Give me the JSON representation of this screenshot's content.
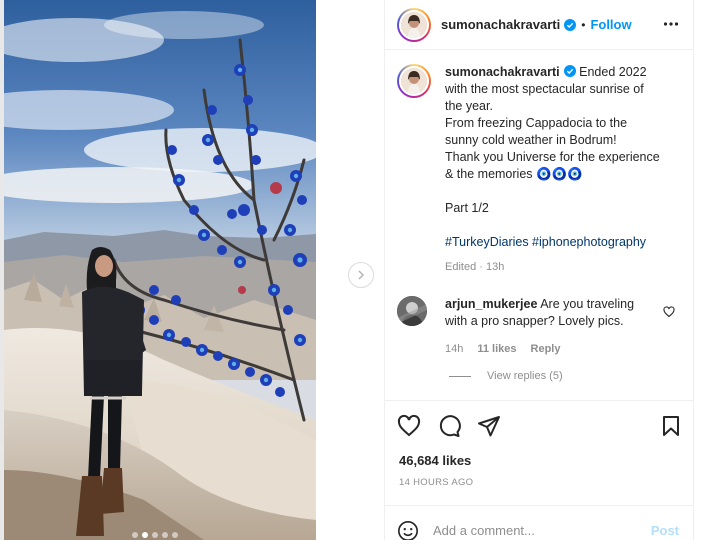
{
  "post": {
    "username": "sumonachakravarti",
    "verified": true,
    "separator": "•",
    "follow_label": "Follow",
    "more_icon": "more-horizontal-icon",
    "caption": {
      "lines": [
        "Ended 2022",
        "with the most spectacular sunrise of",
        "the year.",
        "From freezing Cappadocia to the",
        "sunny cold weather in Bodrum!",
        "Thank you Universe for the experience",
        "& the memories 🧿🧿🧿"
      ],
      "part": "Part 1/2",
      "hashtags": "#TurkeyDiaries #iphonephotography",
      "edited": "Edited · 13h"
    },
    "comment": {
      "username": "arjun_mukerjee",
      "text": "Are you traveling with a pro snapper? Lovely pics.",
      "time": "14h",
      "likes": "11 likes",
      "reply_label": "Reply",
      "view_replies": "View replies (5)"
    },
    "likes": "46,684 likes",
    "timestamp": "14 HOURS AGO",
    "add_comment_placeholder": "Add a comment...",
    "post_label": "Post",
    "carousel": {
      "count": 5,
      "active_index": 1
    },
    "colors": {
      "accent": "#0095f6",
      "text": "#262626",
      "muted": "#8e8e8e",
      "hashtag": "#00376b",
      "post_disabled": "#b2dffc"
    }
  }
}
